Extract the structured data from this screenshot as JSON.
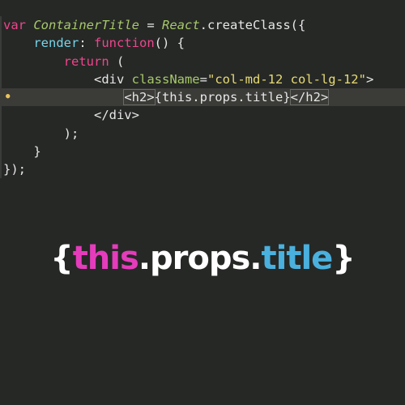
{
  "code": {
    "line1": {
      "kw_var": "var",
      "cls_name": "ContainerTitle",
      "eq": " = ",
      "cls_react": "React",
      "rest": ".createClass({"
    },
    "line2": {
      "indent": "    ",
      "fn_render": "render",
      "colon": ": ",
      "kw_function": "function",
      "rest": "() {"
    },
    "line3": {
      "indent": "        ",
      "kw_return": "return",
      "rest": " ("
    },
    "line4": {
      "indent": "            ",
      "tag_open": "<div",
      "space": " ",
      "attr": "className",
      "eq": "=",
      "str": "\"col-md-12 col-lg-12\"",
      "close": ">"
    },
    "line5": {
      "indent": "                ",
      "tag_h2": "<h2>",
      "expr": "{this.props.title}",
      "tag_h2_end": "</h2>"
    },
    "line6": {
      "indent": "            ",
      "text": "</div>"
    },
    "line7": {
      "indent": "        ",
      "text": ");"
    },
    "line8": {
      "indent": "    ",
      "text": "}"
    },
    "line9": {
      "indent": "",
      "text": "});"
    }
  },
  "caption": {
    "open": "{",
    "this": "this",
    "dot1": ".",
    "props": "props",
    "dot2": ".",
    "title": "title",
    "close": "}"
  },
  "colors": {
    "background": "#262826",
    "keyword": "#f0448c",
    "class": "#a7c86a",
    "function": "#78d4e8",
    "string": "#e7db74",
    "caption_this": "#e43cbb",
    "caption_title": "#4ab0de"
  },
  "icons": {
    "bookmark_marker": "lightbulb-icon"
  }
}
